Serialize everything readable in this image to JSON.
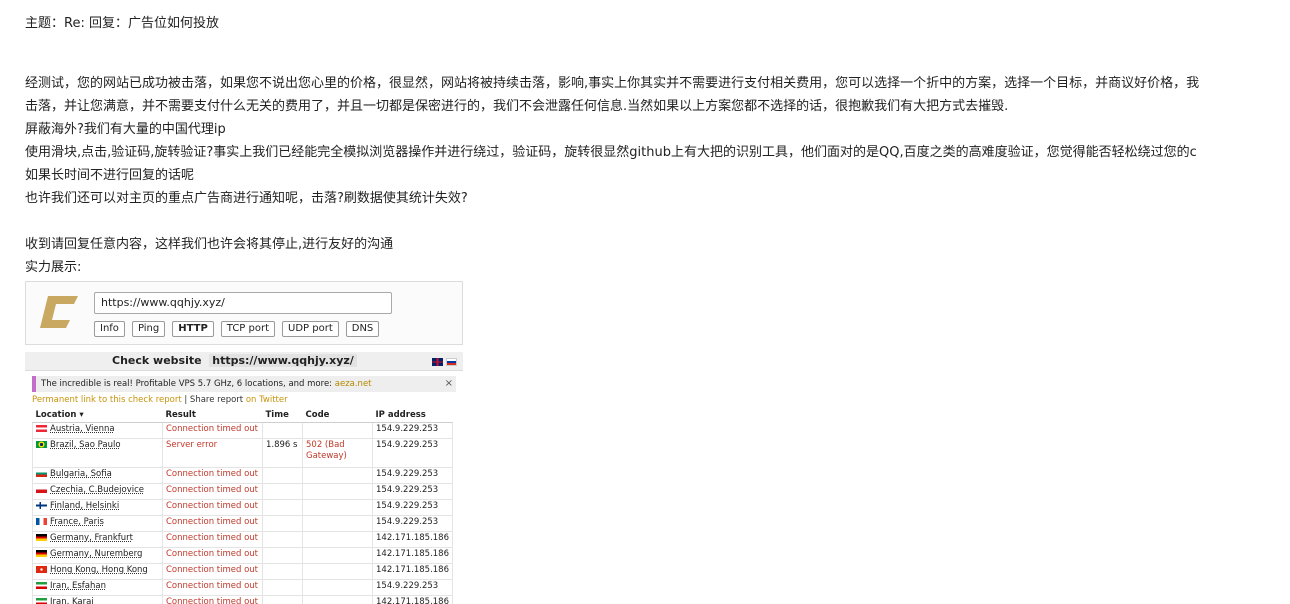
{
  "email": {
    "subject": "主题：Re: 回复：广告位如何投放",
    "body": [
      "经测试，您的网站已成功被击落，如果您不说出您心里的价格，很显然，网站将被持续击落，影响,事实上你其实并不需要进行支付相关费用，您可以选择一个折中的方案，选择一个目标，并商议好价格，我",
      "击落，并让您满意，并不需要支付什么无关的费用了，并且一切都是保密进行的，我们不会泄露任何信息.当然如果以上方案您都不选择的话，很抱歉我们有大把方式去摧毁.",
      "屏蔽海外?我们有大量的中国代理ip",
      "使用滑块,点击,验证码,旋转验证?事实上我们已经能完全模拟浏览器操作并进行绕过，验证码，旋转很显然github上有大把的识别工具，他们面对的是QQ,百度之类的高难度验证，您觉得能否轻松绕过您的c",
      "如果长时间不进行回复的话呢",
      "也许我们还可以对主页的重点广告商进行通知呢，击落?刷数据使其统计失效?",
      "收到请回复任意内容，这样我们也许会将其停止,进行友好的沟通",
      "实力展示:"
    ]
  },
  "screenshot": {
    "url_input_value": "https://www.qqhjy.xyz/",
    "tabs": [
      "Info",
      "Ping",
      "HTTP",
      "TCP port",
      "UDP port",
      "DNS"
    ],
    "active_tab": "HTTP",
    "panel_title": "Check website",
    "panel_url": "https://www.qqhjy.xyz/",
    "ad_text": "The incredible is real! Profitable VPS 5.7 GHz, 6 locations, and more: ",
    "ad_link": "aeza.net",
    "ad_close": "×",
    "permanent_link": "Permanent link to this check report",
    "share_sep": " | Share report ",
    "share_link": "on Twitter",
    "columns": [
      "Location ▾",
      "Result",
      "Time",
      "Code",
      "IP address"
    ],
    "rows": [
      {
        "location": "Austria, Vienna",
        "flag": "at",
        "result": "Connection timed out",
        "time": "",
        "code": "",
        "ip": "154.9.229.253"
      },
      {
        "location": "Brazil, Sao Paulo",
        "flag": "br",
        "result": "Server error",
        "time": "1.896 s",
        "code": "502 (Bad Gateway)",
        "ip": "154.9.229.253"
      },
      {
        "location": "Bulgaria, Sofia",
        "flag": "bg",
        "result": "Connection timed out",
        "time": "",
        "code": "",
        "ip": "154.9.229.253"
      },
      {
        "location": "Czechia, C.Budejovice",
        "flag": "cz",
        "result": "Connection timed out",
        "time": "",
        "code": "",
        "ip": "154.9.229.253"
      },
      {
        "location": "Finland, Helsinki",
        "flag": "fi",
        "result": "Connection timed out",
        "time": "",
        "code": "",
        "ip": "154.9.229.253"
      },
      {
        "location": "France, Paris",
        "flag": "fr",
        "result": "Connection timed out",
        "time": "",
        "code": "",
        "ip": "154.9.229.253"
      },
      {
        "location": "Germany, Frankfurt",
        "flag": "de",
        "result": "Connection timed out",
        "time": "",
        "code": "",
        "ip": "142.171.185.186"
      },
      {
        "location": "Germany, Nuremberg",
        "flag": "de",
        "result": "Connection timed out",
        "time": "",
        "code": "",
        "ip": "142.171.185.186"
      },
      {
        "location": "Hong Kong, Hong Kong",
        "flag": "hk",
        "result": "Connection timed out",
        "time": "",
        "code": "",
        "ip": "142.171.185.186"
      },
      {
        "location": "Iran, Esfahan",
        "flag": "ir",
        "result": "Connection timed out",
        "time": "",
        "code": "",
        "ip": "154.9.229.253"
      },
      {
        "location": "Iran, Karaj",
        "flag": "ir",
        "result": "Connection timed out",
        "time": "",
        "code": "",
        "ip": "142.171.185.186"
      }
    ]
  }
}
